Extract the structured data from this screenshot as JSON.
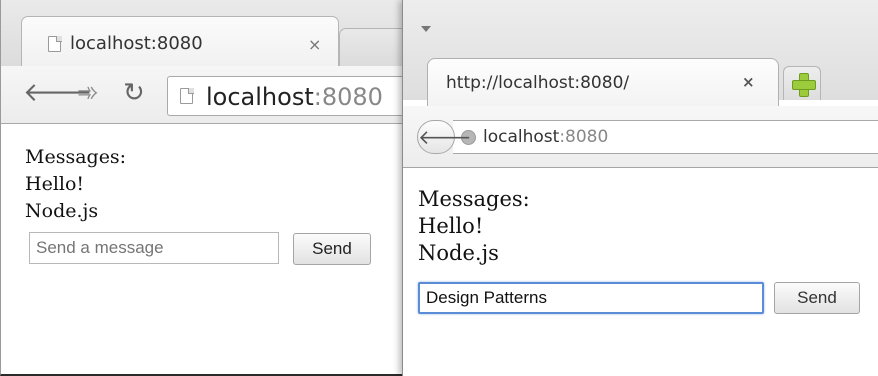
{
  "left_browser": {
    "tab_title": "localhost:8080",
    "tab_close": "×",
    "nav": {
      "back_icon": "back-arrow-icon",
      "forward_icon": "forward-arrow-icon",
      "reload_icon": "reload-icon"
    },
    "url_host": "localhost",
    "url_port": ":8080",
    "page": {
      "heading": "Messages:",
      "messages": [
        "Hello!",
        "Node.js"
      ],
      "input_placeholder": "Send a message",
      "input_value": "",
      "send_label": "Send"
    }
  },
  "right_browser": {
    "tab_title": "http://localhost:8080/",
    "tab_close": "×",
    "nav": {
      "back_icon": "back-arrow-icon",
      "site_icon": "globe-icon",
      "new_tab_icon": "plus-icon"
    },
    "url_host": "localhost",
    "url_port": ":8080",
    "page": {
      "heading": "Messages:",
      "messages": [
        "Hello!",
        "Node.js"
      ],
      "input_placeholder": "",
      "input_value": "Design Patterns",
      "send_label": "Send"
    }
  },
  "colors": {
    "focus_ring": "#5b8dd6",
    "new_tab_plus": "#9ccc3c"
  }
}
